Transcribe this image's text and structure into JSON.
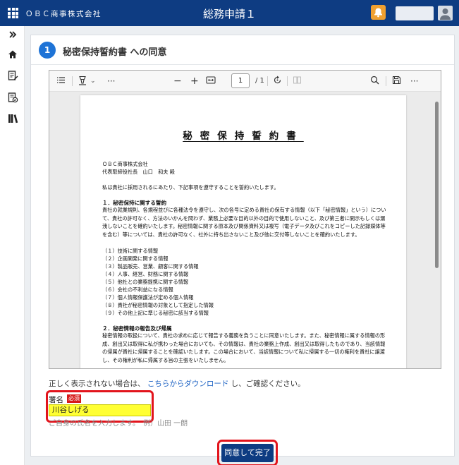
{
  "header": {
    "company": "ＯＢＣ商事株式会社",
    "title": "総務申請１",
    "icons": [
      "grid-icon",
      "bell-icon",
      "user-icon"
    ],
    "bell_color": "#f0a030",
    "bar_color": "#0e3c82"
  },
  "rail": {
    "items": [
      "expand-icon",
      "home-icon",
      "edit-document-icon",
      "document-check-icon",
      "books-icon"
    ]
  },
  "step": {
    "number": "1",
    "title": "秘密保持誓約書 への同意"
  },
  "viewer": {
    "page_current": "1",
    "page_total": "/ 1",
    "minus": "−",
    "plus": "+",
    "more": "···"
  },
  "document": {
    "title": "秘密保持誓約書",
    "addressee_company": "ＯＢＣ商事株式会社",
    "addressee": "代表取締役社長　山口　和夫 殿",
    "intro": "私は貴社に採用されるにあたり、下記事項を遵守することを誓約いたします。",
    "section1_heading": "１．秘密保持に関する誓約",
    "section1_text": "貴社の就業規則、各規程並びに各種法令を遵守し、次の各号に定める貴社の保有する情報（以下「秘密情報」という）について、貴社の許可なく、方法のいかんを問わず、業務上必要な目的以外の目的で使用しないこと、及び第三者に開示もしくは漏洩しないことを確約いたします。秘密情報に関する原本及び関係資料又は複写（電子データ及びこれをコピーした記録媒体等を含む）等については、貴社の許可なく、社外に持ち出さないこと及び他に交付等しないことを確約いたします。",
    "items": [
      "（１）技術に関する情報",
      "（２）企画開発に関する情報",
      "（３）製品販売、営業、顧客に関する情報",
      "（４）人事、経営、財務に関する情報",
      "（５）他社との業務提携に関する情報",
      "（６）会社の不利益になる情報",
      "（７）個人情報保護法が定める個人情報",
      "（８）貴社が秘密情報の対象として指定した情報",
      "（９）その他上記に準じる秘密に該当する情報"
    ],
    "section2_heading": "２．秘密情報の報告及び帰属",
    "section2_text": "秘密情報の取扱について、貴社の求めに応じて報告する義務を負うことに同意いたします。また、秘密情報に属する情報の形成、創出又は取得に私が携わった場合においても、その情報は、貴社の業務上作成、創出又は取得したものであり、当該情報の帰属が貴社に帰属することを確認いたします。この場合において、当該情報について私に帰属する一切の権利を貴社に譲渡し、その権利が私に帰属する旨の主張をいたしません。"
  },
  "download": {
    "prefix": "正しく表示されない場合は、",
    "link": "こちらからダウンロード",
    "suffix": "し、ご確認ください。"
  },
  "signature": {
    "label": "署名",
    "required": "必須",
    "value": "川谷しげる",
    "hint": "ご自身の氏名を入力します。　例）山田 一朗"
  },
  "submit": {
    "label": "同意して完了"
  }
}
